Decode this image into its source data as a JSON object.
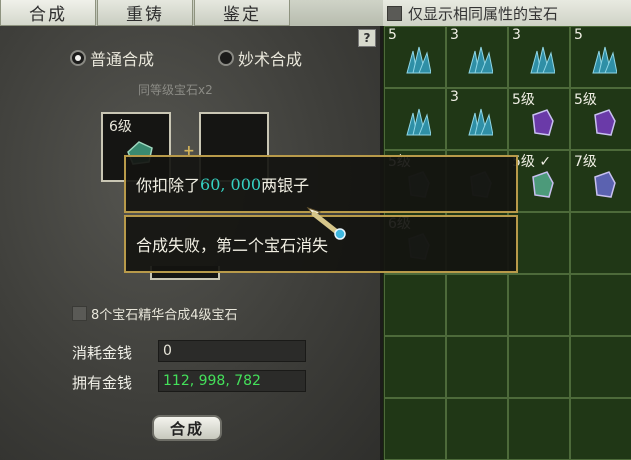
{
  "tabs": [
    "合成",
    "重铸",
    "鉴定"
  ],
  "filter": {
    "label": "仅显示相同属性的宝石",
    "checked": false
  },
  "left_panel": {
    "help_label": "?",
    "modes": [
      {
        "label": "普通合成",
        "selected": true
      },
      {
        "label": "妙术合成",
        "selected": false
      }
    ],
    "requirement_label": "同等级宝石x2",
    "slot1_level": "6级",
    "plus_label": "+",
    "essence_label": "8个宝石精华合成4级宝石",
    "cost_label": "消耗金钱",
    "cost_value": "0",
    "owned_label": "拥有金钱",
    "owned_value": "112, 998, 782",
    "combine_button": "合成"
  },
  "tooltip": {
    "line1_prefix": "你扣除了",
    "line1_amount": "60, 000",
    "line1_suffix": "两银子",
    "line2": "合成失败，第二个宝石消失"
  },
  "inventory": [
    {
      "label": "5",
      "gem": "blue"
    },
    {
      "label": "3",
      "gem": "blue"
    },
    {
      "label": "3",
      "gem": "blue"
    },
    {
      "label": "5",
      "gem": "blue"
    },
    {
      "label": "",
      "gem": "blue"
    },
    {
      "label": "3",
      "gem": "blue"
    },
    {
      "label": "5级",
      "gem": "purple"
    },
    {
      "label": "5级",
      "gem": "purple"
    },
    {
      "label": "5级",
      "gem": "dim"
    },
    {
      "label": "",
      "gem": "dim"
    },
    {
      "label": "5级 ✓",
      "gem": "green"
    },
    {
      "label": "7级",
      "gem": "violet"
    },
    {
      "label": "6级",
      "gem": "dim"
    },
    {
      "label": "",
      "gem": "none"
    },
    {
      "label": "",
      "gem": "none"
    },
    {
      "label": "",
      "gem": "none"
    },
    {
      "label": "",
      "gem": "none"
    },
    {
      "label": "",
      "gem": "none"
    },
    {
      "label": "",
      "gem": "none"
    },
    {
      "label": "",
      "gem": "none"
    },
    {
      "label": "",
      "gem": "none"
    },
    {
      "label": "",
      "gem": "none"
    },
    {
      "label": "",
      "gem": "none"
    },
    {
      "label": "",
      "gem": "none"
    },
    {
      "label": "",
      "gem": "none"
    },
    {
      "label": "",
      "gem": "none"
    },
    {
      "label": "",
      "gem": "none"
    },
    {
      "label": "",
      "gem": "none"
    }
  ],
  "colors": {
    "gem_blue": "#2f8fa6",
    "gem_purple": "#6a3aa8",
    "gem_green": "#4c9a7a",
    "gem_violet": "#5b62b0",
    "gem_dim": "#3b4a48",
    "accent_gold": "#b89a4a",
    "money_green": "#44e05a"
  }
}
